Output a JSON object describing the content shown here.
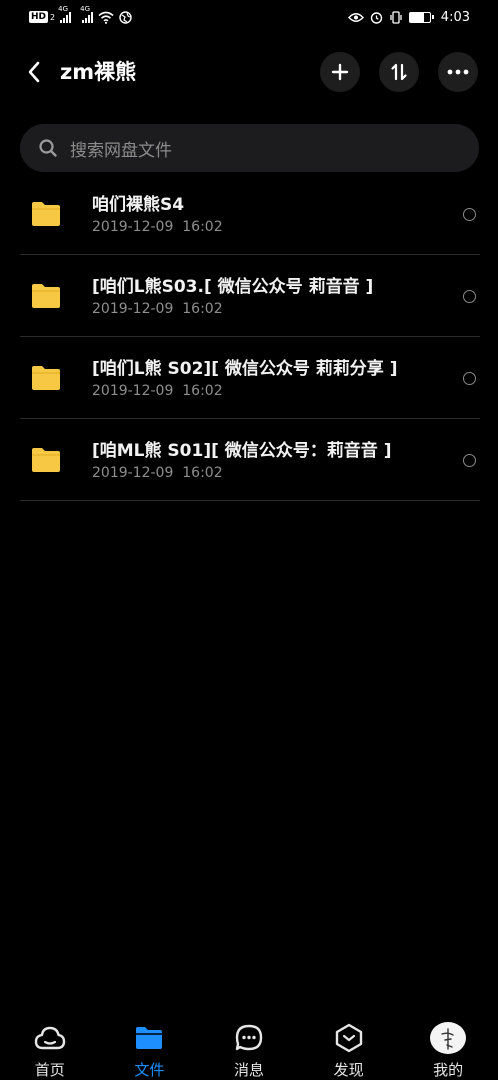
{
  "status_bar": {
    "net_tag_1": "4G",
    "net_tag_2": "4G",
    "sim_tag": "2",
    "hd_badge": "HD",
    "time": "4:03",
    "battery_level": 0.7
  },
  "header": {
    "title": "zm裸熊"
  },
  "search": {
    "placeholder": "搜索网盘文件"
  },
  "files": [
    {
      "name": "咱们裸熊S4",
      "date": "2019-12-09  16:02"
    },
    {
      "name": "[咱们L熊S03.[ 微信公众号 莉音音 ]",
      "date": "2019-12-09  16:02"
    },
    {
      "name": "[咱们L熊 S02][ 微信公众号 莉莉分享 ]",
      "date": "2019-12-09  16:02"
    },
    {
      "name": "[咱ML熊 S01][ 微信公众号：莉音音 ]",
      "date": "2019-12-09  16:02"
    }
  ],
  "bottom_nav": {
    "items": [
      {
        "label": "首页",
        "icon": "cloud-icon"
      },
      {
        "label": "文件",
        "icon": "folder-icon",
        "active": true
      },
      {
        "label": "消息",
        "icon": "chat-icon"
      },
      {
        "label": "发现",
        "icon": "discover-icon"
      },
      {
        "label": "我的",
        "icon": "avatar"
      }
    ]
  },
  "colors": {
    "background": "#000000",
    "accent": "#1d8fff",
    "folder": "#f7c843",
    "secondary_text": "#8e8e8e"
  }
}
